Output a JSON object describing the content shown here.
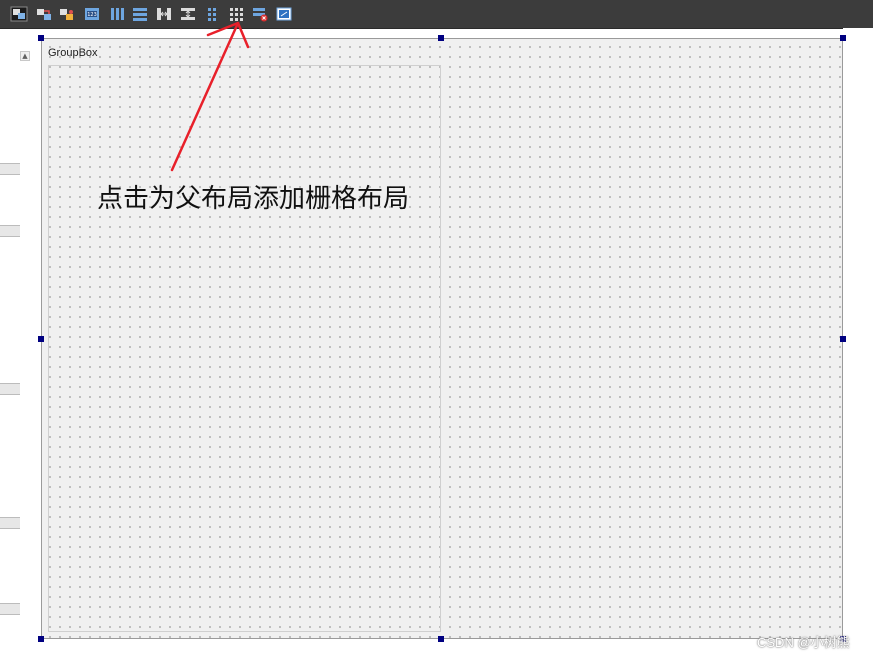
{
  "toolbar": {
    "buttons": [
      {
        "icon": "edit-widgets-icon"
      },
      {
        "icon": "edit-signals-slots-icon"
      },
      {
        "icon": "edit-buddies-icon"
      },
      {
        "icon": "edit-tab-order-icon"
      },
      {
        "icon": "layout-horizontal-icon"
      },
      {
        "icon": "layout-vertical-icon"
      },
      {
        "icon": "layout-horizontal-splitter-icon"
      },
      {
        "icon": "layout-vertical-splitter-icon"
      },
      {
        "icon": "layout-form-icon"
      },
      {
        "icon": "layout-grid-icon"
      },
      {
        "icon": "break-layout-icon"
      },
      {
        "icon": "adjust-size-icon"
      }
    ]
  },
  "form": {
    "groupbox_title": "GroupBox"
  },
  "annotation": {
    "text": "点击为父布局添加栅格布局",
    "arrow_color": "#e8202a"
  },
  "watermark": "CSDN @小树熊",
  "colors": {
    "selection_handle": "#000080",
    "toolbar_bg": "#3c3c3c",
    "form_bg": "#f0f0f0"
  }
}
